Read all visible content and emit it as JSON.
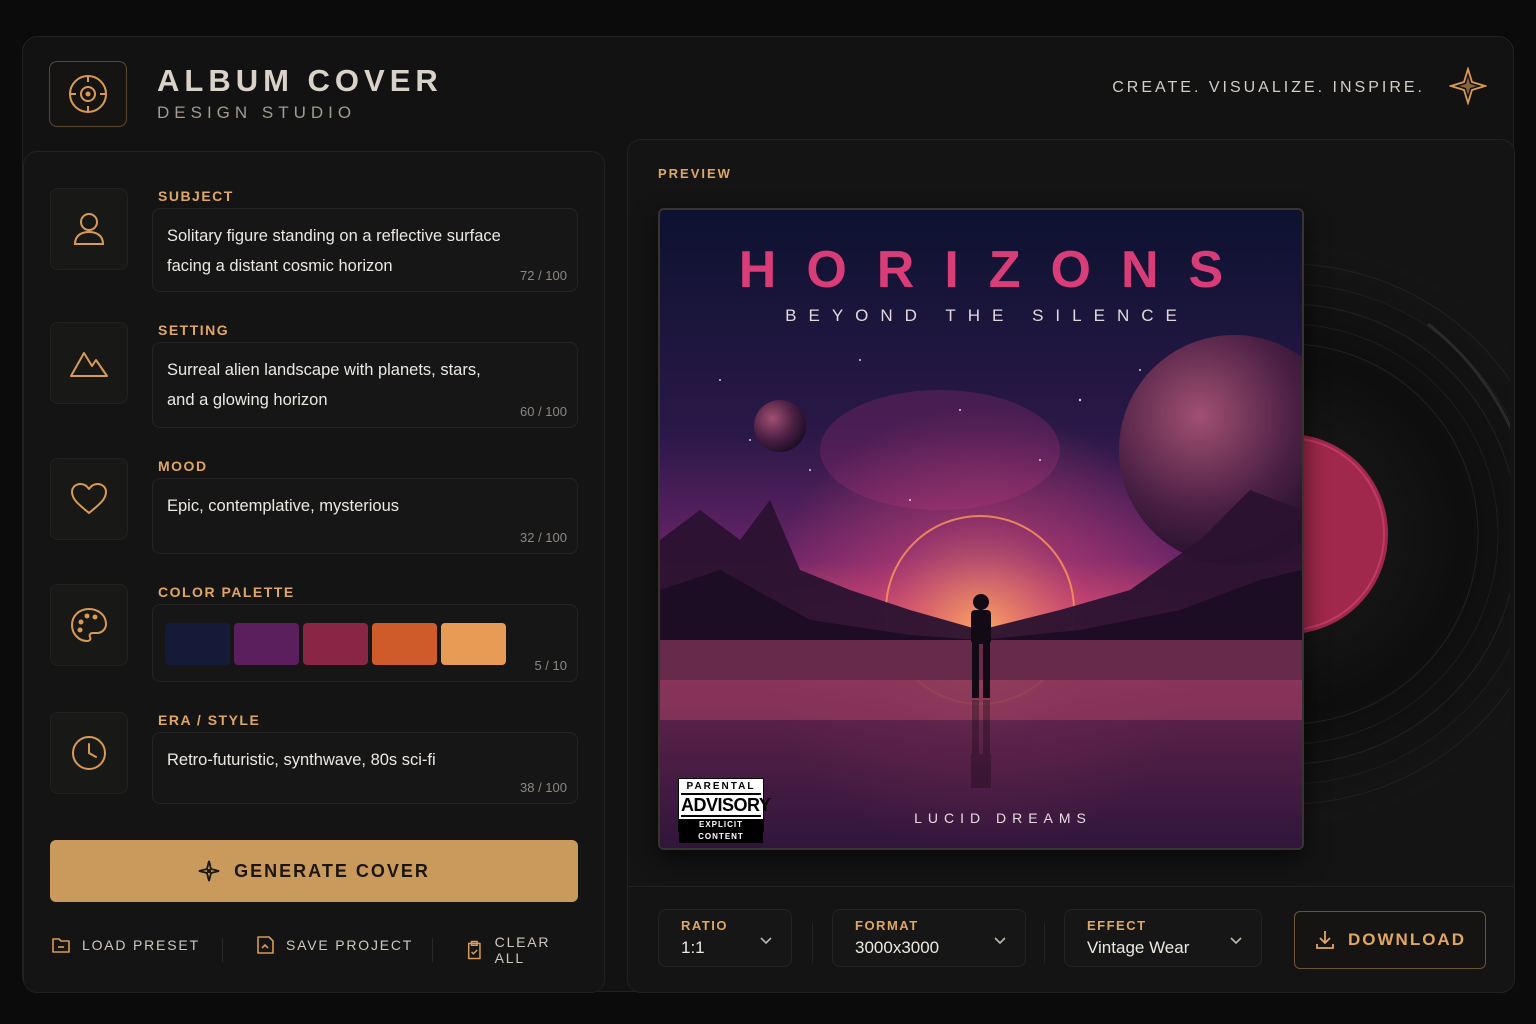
{
  "header": {
    "title": "ALBUM COVER",
    "subtitle": "DESIGN STUDIO",
    "tagline": "CREATE. VISUALIZE. INSPIRE."
  },
  "fields": {
    "subject": {
      "label": "SUBJECT",
      "line1": "Solitary figure standing on a reflective surface",
      "line2": "facing a distant cosmic horizon",
      "count": "72 / 100"
    },
    "setting": {
      "label": "SETTING",
      "line1": "Surreal alien landscape with planets, stars,",
      "line2": "and a glowing horizon",
      "count": "60 / 100"
    },
    "mood": {
      "label": "MOOD",
      "line1": "Epic, contemplative, mysterious",
      "count": "32 / 100"
    },
    "palette": {
      "label": "COLOR PALETTE",
      "count": "5 / 10",
      "colors": [
        "#141a38",
        "#5a1f5c",
        "#8a2545",
        "#cf5a2a",
        "#e89b54"
      ]
    },
    "era": {
      "label": "ERA / STYLE",
      "line1": "Retro-futuristic, synthwave, 80s sci-fi",
      "count": "38 / 100"
    }
  },
  "actions": {
    "generate": "GENERATE COVER",
    "load": "LOAD PRESET",
    "save": "SAVE PROJECT",
    "clear": "CLEAR ALL"
  },
  "preview": {
    "label": "PREVIEW",
    "cover_title": "HORIZONS",
    "cover_subtitle": "BEYOND THE SILENCE",
    "cover_artist": "LUCID DREAMS",
    "advisory": {
      "top": "PARENTAL",
      "mid": "ADVISORY",
      "bottom": "EXPLICIT CONTENT"
    }
  },
  "controls": {
    "ratio": {
      "label": "RATIO",
      "value": "1:1"
    },
    "format": {
      "label": "FORMAT",
      "value": "3000x3000"
    },
    "effect": {
      "label": "EFFECT",
      "value": "Vintage Wear"
    },
    "download": "DOWNLOAD"
  },
  "colors": {
    "accent": "#e0a763",
    "button": "#c99a5c",
    "title_pink": "#d93d78"
  }
}
